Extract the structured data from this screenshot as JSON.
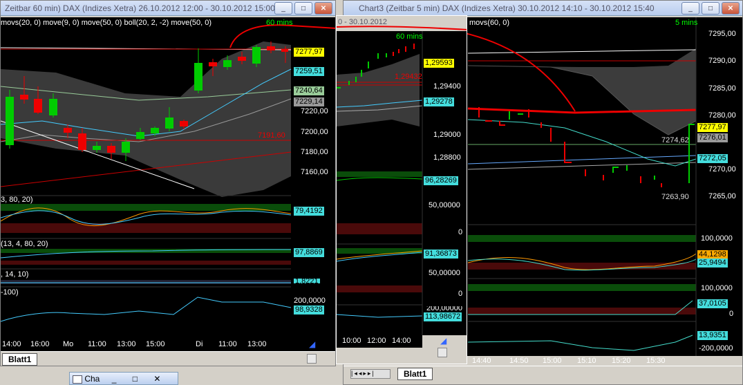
{
  "windows": {
    "left": {
      "title": "Zeitbar 60 min)  DAX (Indizes Xetra) 26.10.2012 12:00 - 30.10.2012 15:00",
      "indicator_line": "movs(20, 0) move(9, 0) move(50, 0) boll(20, 2, -2) move(50, 0)",
      "timeframe": "60 mins",
      "yaxis": [
        "7220,00",
        "7200,00",
        "7180,00",
        "7160,00"
      ],
      "price_tags": [
        "7277,97",
        "7259,51",
        "7240,64",
        "7229,14"
      ],
      "red_line_label": "7191,60",
      "panel2_label": "3, 80, 20)",
      "panel2_tag": "79,4192",
      "panel3_label": "(13, 4, 80, 20)",
      "panel3_tag": "97,8869",
      "panel4_label": ", 14, 10)",
      "panel4_tag": "1,8221",
      "panel5_label": "-100)",
      "panel5_tags": [
        "200,0000",
        "98,9328"
      ],
      "xaxis": [
        "14:00",
        "16:00",
        "Mo",
        "11:00",
        "13:00",
        "15:00",
        "Di",
        "11:00",
        "13:00"
      ],
      "sheet_tab": "Blatt1"
    },
    "middle": {
      "title": "Chart3 (Zeitbar 5 min)  DAX (Indizes Xetra) 30.10.2012 14:10 - 30.10.2012 15:40",
      "small_title": "0 - 30.10.2012",
      "timeframe": "60 mins",
      "yaxis": [
        "1,29400",
        "1,29000",
        "1,28800"
      ],
      "price_tags": [
        "1,29593",
        "1,29278"
      ],
      "red_line_label": "1,29432",
      "panel2_tags": [
        "96,28269",
        "50,00000",
        "0"
      ],
      "panel3_tags": [
        "91,36873",
        "50,00000",
        "0"
      ],
      "panel4_tags": [
        "200,00000",
        "113,98672"
      ],
      "xaxis": [
        "10:00",
        "12:00",
        "14:00"
      ]
    },
    "right": {
      "indicator_line": "movs(60, 0)",
      "timeframe": "5 mins",
      "yaxis": [
        "7295,00",
        "7290,00",
        "7285,00",
        "7280,00",
        "7270,00",
        "7265,00"
      ],
      "price_tags": [
        "7277,97",
        "7276,01",
        "7272,05"
      ],
      "labels": [
        "7274,62",
        "7263,90"
      ],
      "panel2_tags": [
        "100,0000",
        "44,1298",
        "25,9494"
      ],
      "panel3_tags": [
        "100,0000",
        "37,0105",
        "0"
      ],
      "panel4_tags": [
        "13,9351",
        "-200,0000"
      ],
      "xaxis": [
        "14:40",
        "14:50",
        "15:00",
        "15:10",
        "15:20",
        "15:30"
      ],
      "sheet_tab": "Blatt1"
    }
  },
  "taskbar": {
    "item1": "Cha"
  },
  "window_buttons": {
    "min": "_",
    "max": "□",
    "close": "✕"
  }
}
